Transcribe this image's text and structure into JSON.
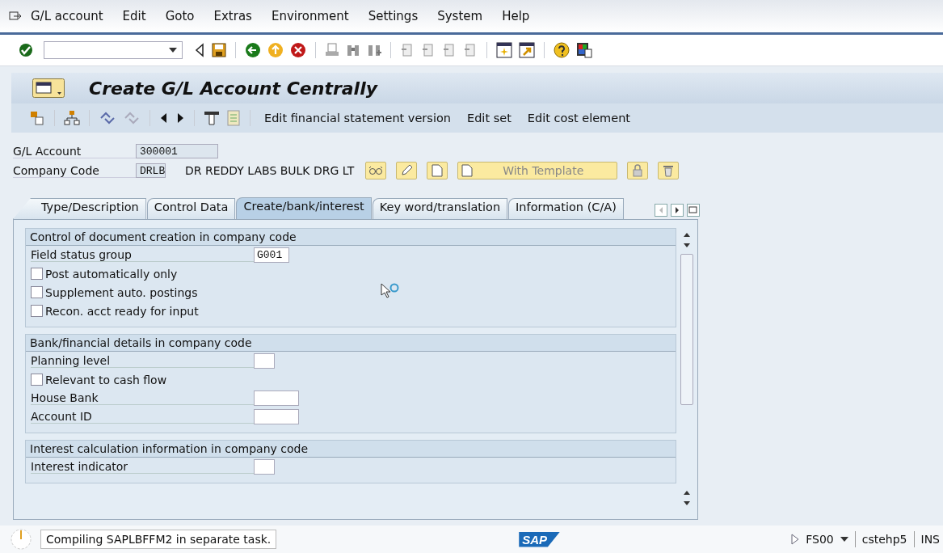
{
  "menu": [
    "G/L account",
    "Edit",
    "Goto",
    "Extras",
    "Environment",
    "Settings",
    "System",
    "Help"
  ],
  "title": "Create G/L Account Centrally",
  "app_toolbar": [
    "Edit financial statement version",
    "Edit set",
    "Edit cost element"
  ],
  "header": {
    "gl_account": {
      "label": "G/L Account",
      "value": "300001"
    },
    "company_code": {
      "label": "Company Code",
      "value": "DRLB",
      "description": "DR REDDY LABS BULK DRG LT"
    },
    "template_button": "With Template"
  },
  "tabs": [
    {
      "label": "Type/Description",
      "selected": false
    },
    {
      "label": "Control Data",
      "selected": false
    },
    {
      "label": "Create/bank/interest",
      "selected": true
    },
    {
      "label": "Key word/translation",
      "selected": false
    },
    {
      "label": "Information (C/A)",
      "selected": false
    }
  ],
  "sections": [
    {
      "title": "Control of document creation in company code",
      "rows": [
        {
          "kind": "field",
          "label": "Field status group",
          "value": "G001"
        },
        {
          "kind": "checkbox",
          "label": "Post automatically only",
          "checked": false
        },
        {
          "kind": "checkbox",
          "label": "Supplement auto. postings",
          "checked": false
        },
        {
          "kind": "checkbox",
          "label": "Recon. acct ready for input",
          "checked": false
        }
      ]
    },
    {
      "title": "Bank/financial details in company code",
      "rows": [
        {
          "kind": "field",
          "label": "Planning level",
          "value": ""
        },
        {
          "kind": "checkbox",
          "label": "Relevant to cash flow",
          "checked": false
        },
        {
          "kind": "field",
          "label": "House Bank",
          "value": ""
        },
        {
          "kind": "field",
          "label": "Account ID",
          "value": ""
        }
      ]
    },
    {
      "title": "Interest calculation information in company code",
      "rows": [
        {
          "kind": "field",
          "label": "Interest indicator",
          "value": ""
        }
      ]
    }
  ],
  "status": {
    "message": "Compiling SAPLBFFM2 in separate task.",
    "logo": "SAP",
    "transaction": "FS00",
    "server": "cstehp5",
    "mode": "INS"
  }
}
